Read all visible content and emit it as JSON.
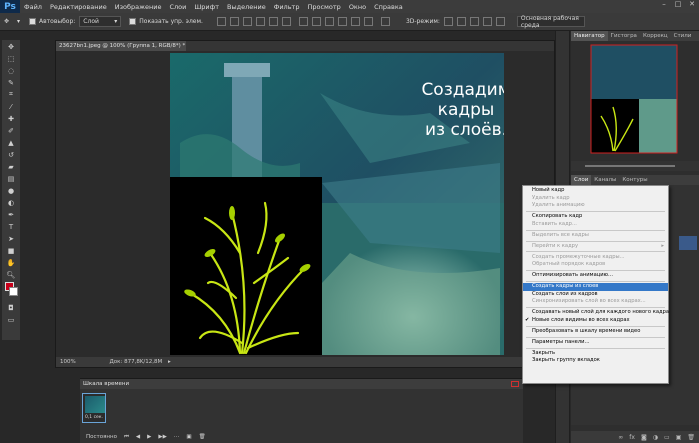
{
  "menu": {
    "logo": "Ps",
    "items": [
      "Файл",
      "Редактирование",
      "Изображение",
      "Слои",
      "Шрифт",
      "Выделение",
      "Фильтр",
      "Просмотр",
      "Окно",
      "Справка"
    ]
  },
  "options": {
    "autoselect_label": "Автовыбор:",
    "autoselect_value": "Слой",
    "show_controls_label": "Показать упр. элем.",
    "workspace": "Основная рабочая среда"
  },
  "document": {
    "tab_title": "23627bn1.jpeg @ 100% (Группа 1, RGB/8*) *",
    "overlay_line1": "Создадим",
    "overlay_line2": "кадры",
    "overlay_line3": "из слоёв.",
    "zoom": "100%",
    "doc_info": "Док: 877,8K/12,8M"
  },
  "panels": {
    "top_tabs": [
      "Навигатор",
      "Гистогра",
      "Коррекц",
      "Стили"
    ],
    "layer_tabs": [
      "Слои",
      "Каналы",
      "Контуры"
    ]
  },
  "context_menu": {
    "items": [
      {
        "label": "Новый кадр",
        "state": "normal"
      },
      {
        "label": "Удалить кадр",
        "state": "disabled"
      },
      {
        "label": "Удалить анимацию",
        "state": "disabled"
      },
      {
        "sep": true
      },
      {
        "label": "Скопировать кадр",
        "state": "normal"
      },
      {
        "label": "Вставить кадр...",
        "state": "disabled"
      },
      {
        "sep": true
      },
      {
        "label": "Выделить все кадры",
        "state": "disabled"
      },
      {
        "sep": true
      },
      {
        "label": "Перейти к кадру",
        "state": "disabled",
        "submenu": true
      },
      {
        "sep": true
      },
      {
        "label": "Создать промежуточные кадры...",
        "state": "disabled"
      },
      {
        "label": "Обратный порядок кадров",
        "state": "disabled"
      },
      {
        "sep": true
      },
      {
        "label": "Оптимизировать анимацию...",
        "state": "normal"
      },
      {
        "sep": true
      },
      {
        "label": "Создать кадры из слоев",
        "state": "selected"
      },
      {
        "label": "Создать слои из кадров",
        "state": "normal"
      },
      {
        "label": "Синхронизировать слой во всех кадрах...",
        "state": "disabled"
      },
      {
        "sep": true
      },
      {
        "label": "Создавать новый слой для каждого нового кадра",
        "state": "normal"
      },
      {
        "label": "Новые слои видимы во всех кадрах",
        "state": "normal",
        "checked": true
      },
      {
        "sep": true
      },
      {
        "label": "Преобразовать в шкалу времени видео",
        "state": "normal"
      },
      {
        "sep": true
      },
      {
        "label": "Параметры панели...",
        "state": "normal"
      },
      {
        "sep": true
      },
      {
        "label": "Закрыть",
        "state": "normal"
      },
      {
        "label": "Закрыть группу вкладок",
        "state": "normal"
      }
    ]
  },
  "timeline": {
    "title": "Шкала времени",
    "frame_duration": "0,1 сек.",
    "loop": "Постоянно"
  },
  "colors": {
    "accent": "#3478c8",
    "plant": "#c8e614",
    "canvas_bg": "#1d4a55"
  }
}
